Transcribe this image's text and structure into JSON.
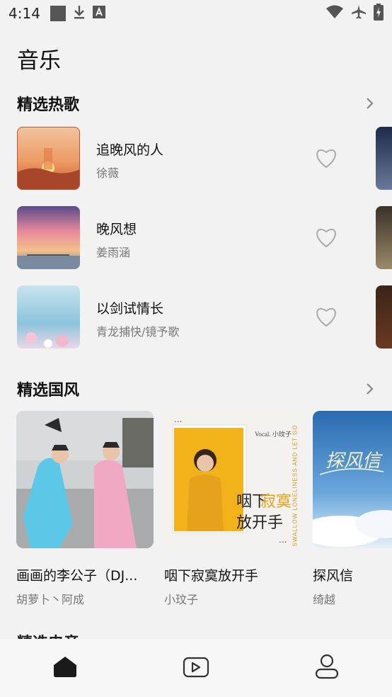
{
  "status_bar": {
    "time": "4:14",
    "left_icons": [
      "square-icon",
      "download-icon",
      "a-icon"
    ],
    "right_icons": [
      "wifi-icon",
      "airplane-icon",
      "battery-icon"
    ]
  },
  "page": {
    "title": "音乐"
  },
  "hot_songs": {
    "title": "精选热歌",
    "more_icon": "chevron-right-icon",
    "songs": [
      {
        "title": "追晚风的人",
        "artist": "徐薇",
        "favorite_icon": "heart-outline-icon"
      },
      {
        "title": "晚风想",
        "artist": "姜雨涵",
        "favorite_icon": "heart-outline-icon"
      },
      {
        "title": "以剑试情长",
        "artist": "青龙捕快/镜予歌",
        "favorite_icon": "heart-outline-icon"
      }
    ]
  },
  "guofeng": {
    "title": "精选国风",
    "more_icon": "chevron-right-icon",
    "albums": [
      {
        "title": "画画的李公子（DJ...",
        "artist": "胡萝卜丶阿成"
      },
      {
        "title": "咽下寂寞放开手",
        "artist": "小玟子",
        "cover_text": [
          "咽下",
          "寂寞",
          "放开手",
          "Vocal. 小玟子",
          "SWALLOW LONELINESS AND LET GO"
        ]
      },
      {
        "title": "探风信",
        "artist": "绮越",
        "cover_text": "探风信"
      }
    ]
  },
  "next_section": {
    "title": "精选电音"
  },
  "bottom_nav": {
    "items": [
      {
        "name": "home",
        "icon": "home-icon",
        "active": true
      },
      {
        "name": "video",
        "icon": "video-icon",
        "active": false
      },
      {
        "name": "profile",
        "icon": "user-icon",
        "active": false
      }
    ]
  },
  "colors": {
    "background": "#f2f2f2",
    "accent": "#1a1a1a",
    "muted": "#777777"
  }
}
